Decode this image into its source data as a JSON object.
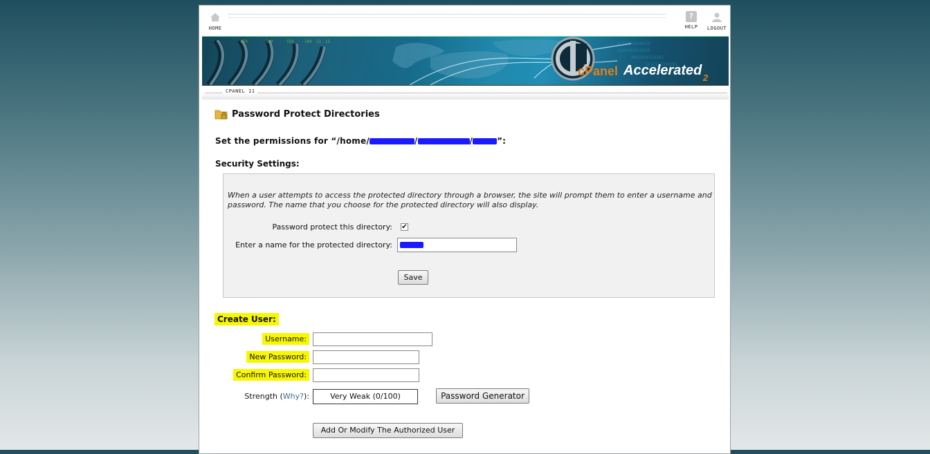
{
  "nav": {
    "home_label": "HOME",
    "help_label": "HELP",
    "logout_label": "LOGOUT"
  },
  "banner": {
    "brand": "cPanel",
    "product": "Accelerated",
    "version_mark": "2"
  },
  "tab": {
    "label": "CPANEL 11"
  },
  "page": {
    "title": "Password Protect Directories",
    "permissions_prefix": "Set the permissions for “/home/",
    "permissions_suffix": "”:"
  },
  "security": {
    "heading": "Security Settings:",
    "description": "When a user attempts to access the protected directory through a browser, the site will prompt them to enter a username and password. The name that you choose for the protected directory will also display.",
    "protect_label": "Password protect this directory:",
    "protect_checked": true,
    "name_label": "Enter a name for the protected directory:",
    "save_label": "Save"
  },
  "create_user": {
    "heading": "Create User:",
    "username_label": "Username:",
    "username_value": "",
    "new_password_label": "New Password:",
    "new_password_value": "",
    "confirm_password_label": "Confirm Password:",
    "confirm_password_value": "",
    "strength_label": "Strength (",
    "why_link": "Why?",
    "strength_label_end": "):",
    "strength_value": "Very Weak (0/100)",
    "generator_label": "Password Generator",
    "submit_label": "Add Or Modify The Authorized User"
  },
  "colors": {
    "highlight": "#f7f700",
    "redaction": "#1a1aff",
    "link": "#3a6c94"
  }
}
